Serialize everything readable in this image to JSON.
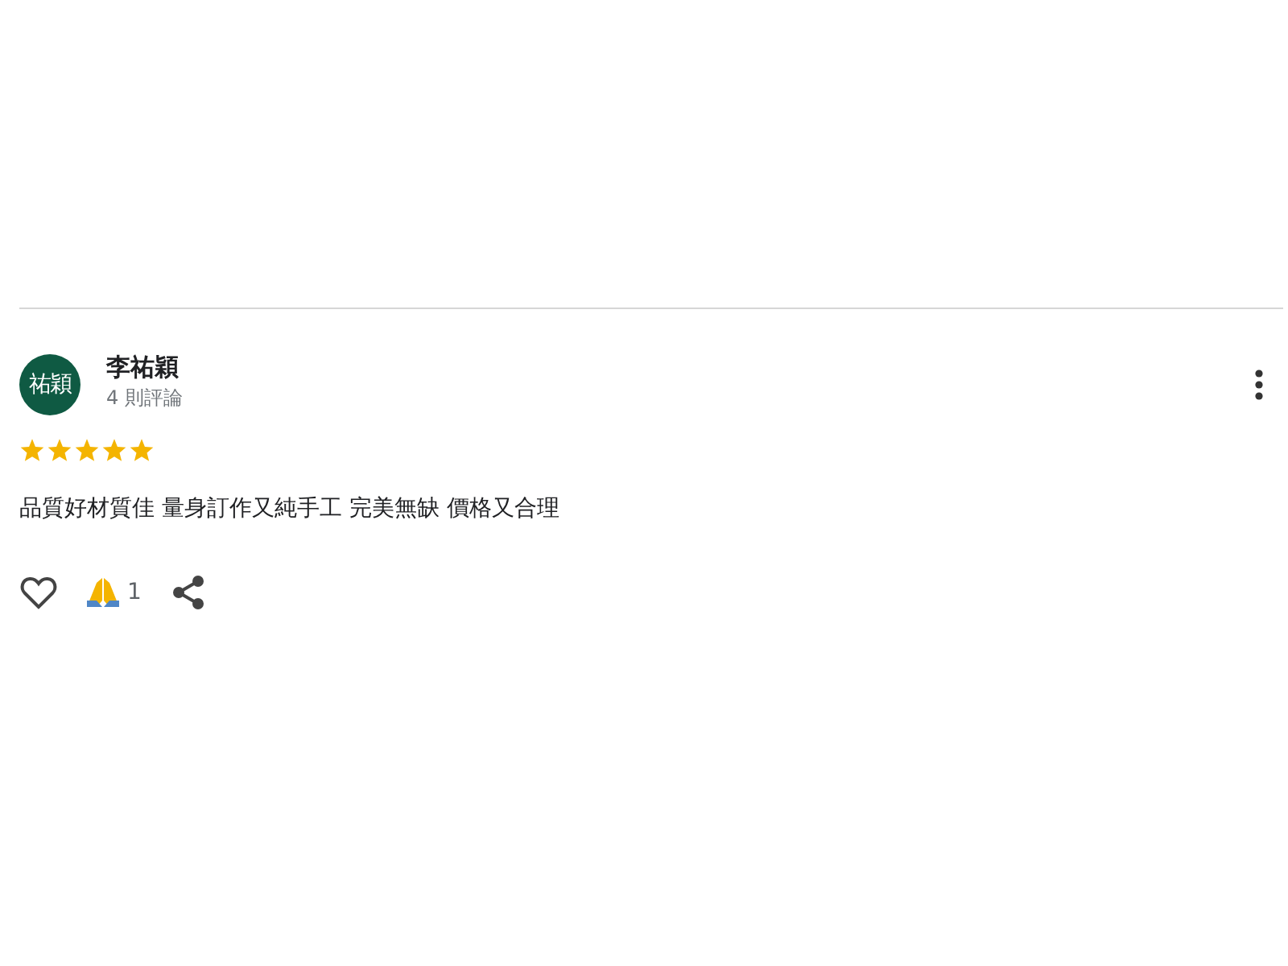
{
  "review": {
    "avatar": "祐穎",
    "author": "李祐穎",
    "review_count": "4 則評論",
    "stars": 5,
    "text": "品質好材質佳 量身訂作又純手工 完美無缺 價格又合理",
    "liked": false,
    "reaction_count": "1"
  }
}
